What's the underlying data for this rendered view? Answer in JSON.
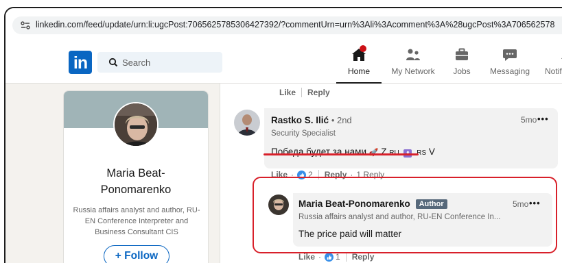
{
  "browser": {
    "url": "linkedin.com/feed/update/urn:li:ugcPost:7065625785306427392/?commentUrn=urn%3Ali%3Acomment%3A%28ugcPost%3A706562578"
  },
  "nav": {
    "logo_text": "in",
    "search_placeholder": "Search",
    "items": [
      {
        "label": "Home",
        "icon": "home-icon",
        "active": true
      },
      {
        "label": "My Network",
        "icon": "network-icon"
      },
      {
        "label": "Jobs",
        "icon": "briefcase-icon"
      },
      {
        "label": "Messaging",
        "icon": "messaging-icon"
      },
      {
        "label": "Notifica",
        "icon": "bell-icon"
      }
    ]
  },
  "profile": {
    "name": "Maria Beat-Ponomarenko",
    "name_line1": "Maria Beat-",
    "name_line2": "Ponomarenko",
    "headline": "Russia affairs analyst and author, RU-EN Conference Interpreter and Business Consultant CIS",
    "follow_label": "+ Follow"
  },
  "feed": {
    "top_actions": {
      "like": "Like",
      "reply": "Reply"
    },
    "comments": [
      {
        "author": "Rastko S. Ilić",
        "degree": "• 2nd",
        "subtitle": "Security Specialist",
        "time": "5mo",
        "more": "•••",
        "text": "Победа будет за нами",
        "text_suffix_z": "Z",
        "text_suffix_ru": "RU",
        "text_suffix_rs": "RS",
        "text_suffix_v": "V",
        "actions": {
          "like": "Like",
          "like_count": "2",
          "reply": "Reply",
          "reply_count": "1 Reply"
        }
      },
      {
        "author": "Maria Beat-Ponomarenko",
        "badge": "Author",
        "subtitle": "Russia affairs analyst and author, RU-EN Conference In...",
        "time": "5mo",
        "more": "•••",
        "text": "The price paid will matter",
        "actions": {
          "like": "Like",
          "like_count": "1",
          "reply": "Reply"
        }
      }
    ]
  },
  "colors": {
    "linkedin_blue": "#0a66c2",
    "highlight_red": "#d8202a",
    "page_bg": "#f4f2ee"
  }
}
